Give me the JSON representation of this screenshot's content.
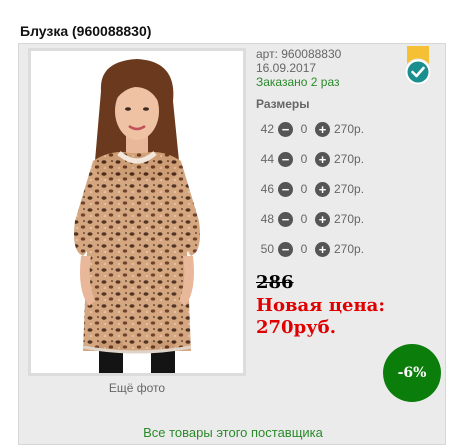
{
  "product": {
    "title": "Блузка (960088830)",
    "article": "арт: 960088830",
    "date": "16.09.2017",
    "ordered": "Заказано 2 раз",
    "more_photos": "Ещё фото",
    "sizes_label": "Размеры",
    "sizes": [
      {
        "size": "42",
        "qty": "0",
        "price": "270р."
      },
      {
        "size": "44",
        "qty": "0",
        "price": "270р."
      },
      {
        "size": "46",
        "qty": "0",
        "price": "270р."
      },
      {
        "size": "48",
        "qty": "0",
        "price": "270р."
      },
      {
        "size": "50",
        "qty": "0",
        "price": "270р."
      }
    ],
    "minus_symbol": "−",
    "plus_symbol": "+",
    "old_price": "286",
    "new_price_label": "Новая цена:",
    "new_price_value": "270руб.",
    "discount": "-6%",
    "supplier_link": "Все товары этого поставщика"
  },
  "colors": {
    "accent_green": "#0b7d0b",
    "new_price_red": "#e00000",
    "badge_yellow": "#f5c033",
    "check_teal": "#1a8f8f"
  },
  "icons": {
    "minus": "minus-circle-icon",
    "plus": "plus-circle-icon",
    "badge": "verified-check-badge-icon"
  }
}
